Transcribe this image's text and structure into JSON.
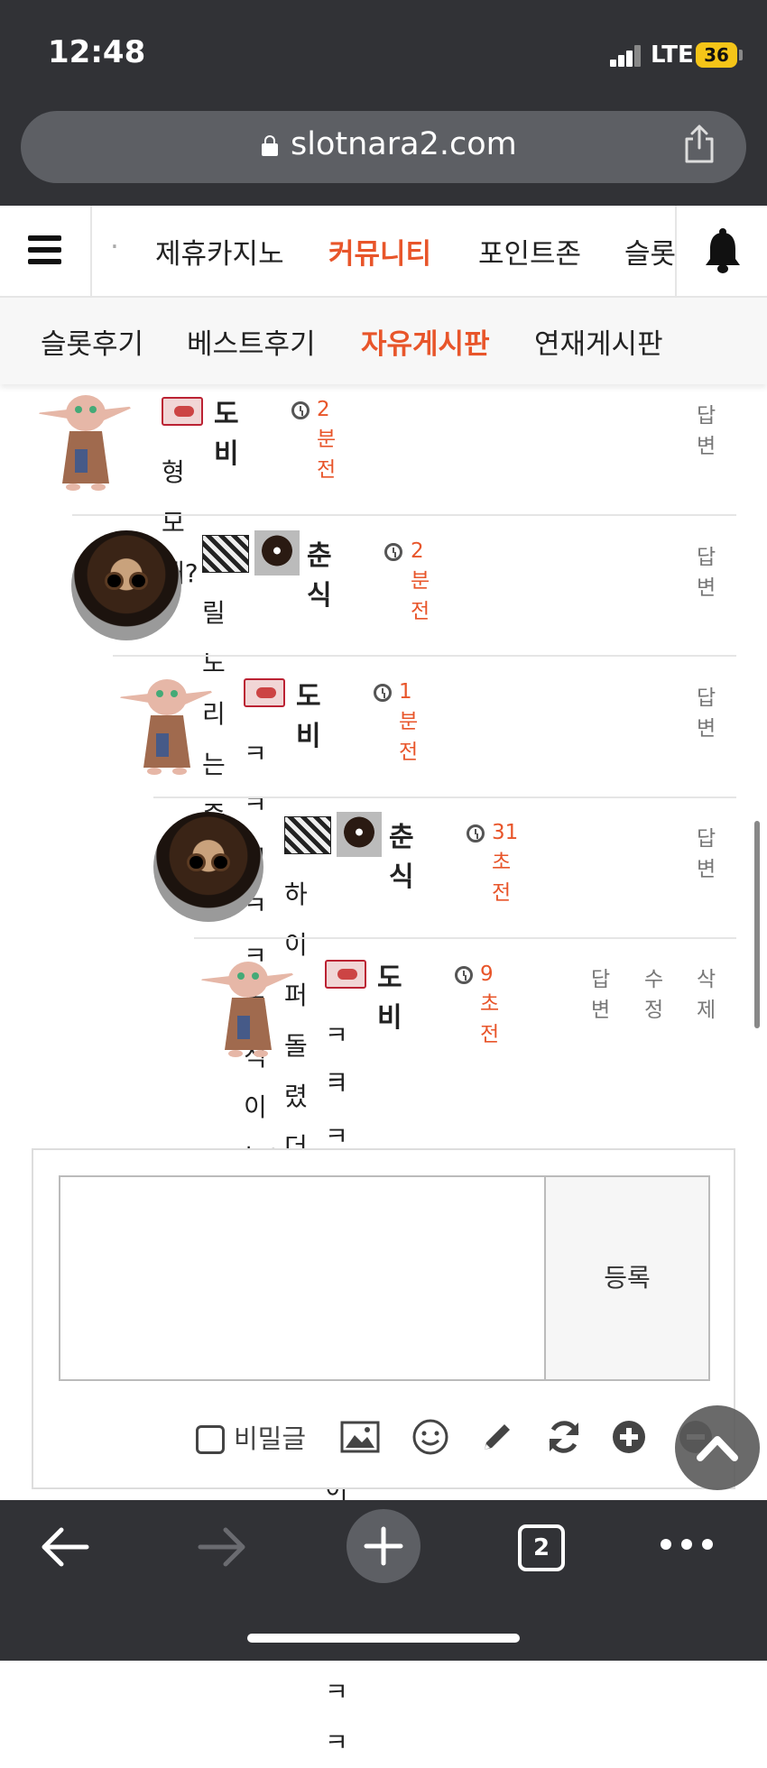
{
  "status": {
    "time": "12:48",
    "network": "LTE",
    "battery": "36"
  },
  "browser": {
    "url": "slotnara2.com",
    "tab_count": "2"
  },
  "nav": {
    "items": [
      "·",
      "제휴카지노",
      "커뮤니티",
      "포인트존",
      "슬롯"
    ],
    "active": "커뮤니티"
  },
  "subnav": {
    "items": [
      "슬롯후기",
      "베스트후기",
      "자유게시판",
      "연재게시판"
    ],
    "active": "자유게시판"
  },
  "comments": [
    {
      "user": "도비",
      "time": "2분전",
      "text": "형 모해?",
      "actions": [
        "답변"
      ]
    },
    {
      "user": "춘식",
      "time": "2분전",
      "text": "릴 노리는중",
      "actions": [
        "답변"
      ]
    },
    {
      "user": "도비",
      "time": "1분전",
      "text": "ㅋㅋㅋㅋㅋ춘식이는?",
      "actions": [
        "답변"
      ]
    },
    {
      "user": "춘식",
      "time": "31초전",
      "text": "하이퍼돌렸더니 잠ㅋㅋ",
      "actions": [
        "답변"
      ]
    },
    {
      "user": "도비",
      "time": "9초전",
      "text_line1": "ㅋㅋㅋㅋㅋㅋㅋㅋ하이퍼 미쳐 ㅋㅋ",
      "text_line2": "ㅋ",
      "actions": [
        "답변",
        "수정",
        "삭제"
      ]
    }
  ],
  "form": {
    "submit_label": "등록",
    "secret_label": "비밀글",
    "textarea_value": ""
  },
  "icons": [
    "image-icon",
    "smile-icon",
    "pencil-icon",
    "refresh-icon",
    "plus-circle-icon",
    "minus-circle-icon"
  ],
  "colors": {
    "accent": "#e8552a",
    "chrome": "#313236"
  }
}
